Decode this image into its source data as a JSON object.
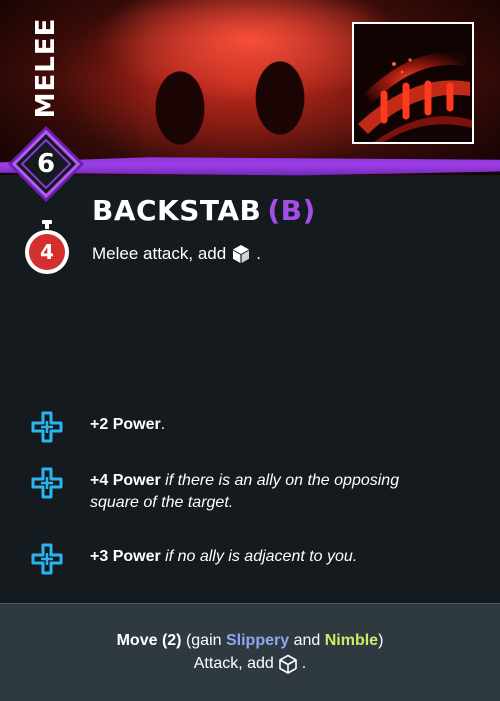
{
  "card": {
    "category": "MELEE",
    "cost": "6",
    "timer": "4",
    "title": "BACKSTAB",
    "title_tag": "(B)",
    "description": "Melee attack, add",
    "description_end": ".",
    "description_icon": "dice-icon"
  },
  "boosts": [
    {
      "icon": "boost-cross-icon",
      "bold": "+2 Power",
      "italic": "",
      "suffix": "."
    },
    {
      "icon": "boost-cross-icon",
      "bold": "+4 Power",
      "italic": "if there is an ally on the opposing square of the target.",
      "suffix": ""
    },
    {
      "icon": "boost-cross-icon",
      "bold": "+3 Power",
      "italic": "if no ally is adjacent to you.",
      "suffix": ""
    }
  ],
  "footer": {
    "move_label": "Move (2)",
    "gain_open": "(gain",
    "slippery": "Slippery",
    "and": "and",
    "nimble": "Nimble",
    "gain_close": ")",
    "attack_text": "Attack, add",
    "attack_end": ".",
    "attack_icon": "dice-outline-icon"
  },
  "colors": {
    "accent_purple": "#9d3fe6",
    "boost_cyan": "#2bb5f0",
    "timer_red": "#d32f2f",
    "slippery": "#8fa6f0",
    "nimble": "#d3e86a",
    "background": "#141a1e",
    "footer_bg": "#2e3a40"
  }
}
